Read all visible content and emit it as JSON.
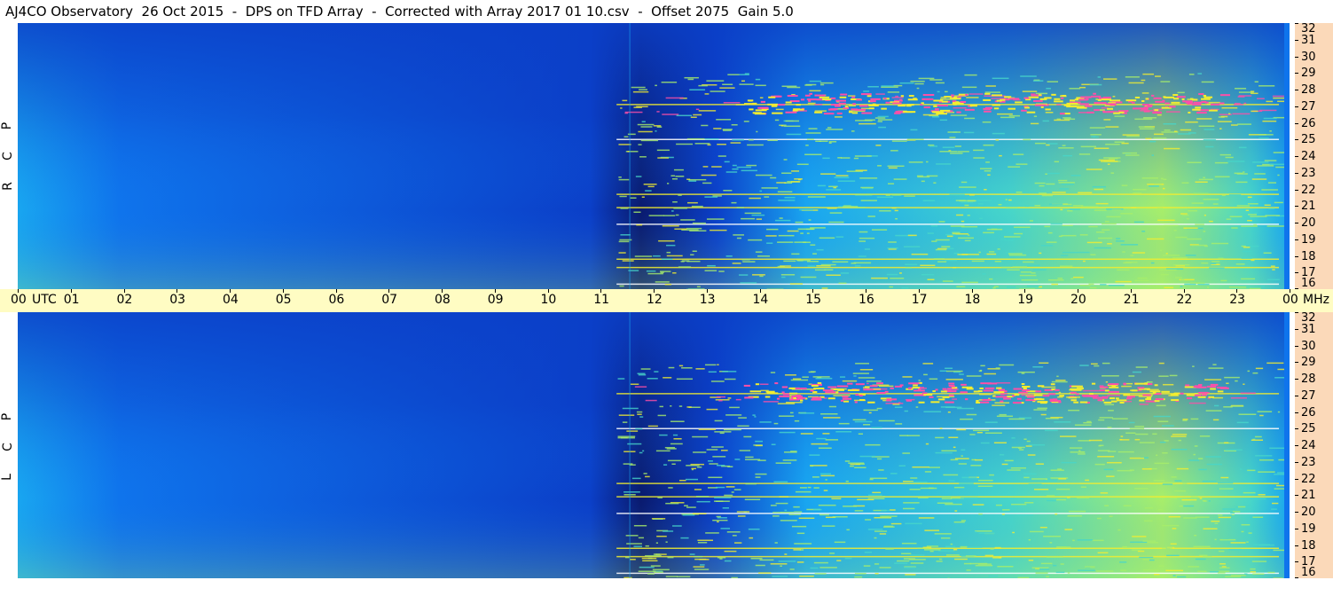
{
  "title": "AJ4CO Observatory  26 Oct 2015  -  DPS on TFD Array  -  Corrected with Array 2017 01 10.csv  -  Offset 2075  Gain 5.0",
  "chart_data": [
    {
      "type": "heatmap",
      "polarization_letters": [
        "R",
        "C",
        "P"
      ],
      "x_axis": {
        "unit": "UTC",
        "range": [
          0,
          24
        ],
        "tick_labels": [
          "00",
          "01",
          "02",
          "03",
          "04",
          "05",
          "06",
          "07",
          "08",
          "09",
          "10",
          "11",
          "12",
          "13",
          "14",
          "15",
          "16",
          "17",
          "18",
          "19",
          "20",
          "21",
          "22",
          "23",
          "00"
        ]
      },
      "y_axis": {
        "unit": "MHz",
        "range": [
          16,
          32
        ],
        "tick_labels": [
          "16",
          "17",
          "18",
          "19",
          "20",
          "21",
          "22",
          "23",
          "24",
          "25",
          "26",
          "27",
          "28",
          "29",
          "30",
          "31",
          "32"
        ]
      },
      "colormap": [
        "#0a1a6e",
        "#0b3fc8",
        "#0f74ec",
        "#19a6f0",
        "#47d6c9",
        "#a8ee6a",
        "#f3ee2f",
        "#ff4fa8",
        "#ffffff"
      ],
      "notable_bands_mhz": [
        16.3,
        17.3,
        17.8,
        19.9,
        20.9,
        21.7,
        25.0,
        27.1
      ]
    },
    {
      "type": "heatmap",
      "polarization_letters": [
        "L",
        "C",
        "P"
      ],
      "x_axis": {
        "unit": "UTC",
        "range": [
          0,
          24
        ],
        "tick_labels": [
          "00",
          "01",
          "02",
          "03",
          "04",
          "05",
          "06",
          "07",
          "08",
          "09",
          "10",
          "11",
          "12",
          "13",
          "14",
          "15",
          "16",
          "17",
          "18",
          "19",
          "20",
          "21",
          "22",
          "23",
          "00"
        ]
      },
      "y_axis": {
        "unit": "MHz",
        "range": [
          16,
          32
        ],
        "tick_labels": [
          "16",
          "17",
          "18",
          "19",
          "20",
          "21",
          "22",
          "23",
          "24",
          "25",
          "26",
          "27",
          "28",
          "29",
          "30",
          "31",
          "32"
        ]
      },
      "colormap": [
        "#0a1a6e",
        "#0b3fc8",
        "#0f74ec",
        "#19a6f0",
        "#47d6c9",
        "#a8ee6a",
        "#f3ee2f",
        "#ff4fa8",
        "#ffffff"
      ],
      "notable_bands_mhz": [
        16.3,
        17.3,
        17.8,
        19.9,
        20.9,
        21.7,
        25.0,
        27.1
      ]
    }
  ],
  "time_axis": {
    "utc_label": "UTC",
    "mhz_label": "MHz"
  }
}
